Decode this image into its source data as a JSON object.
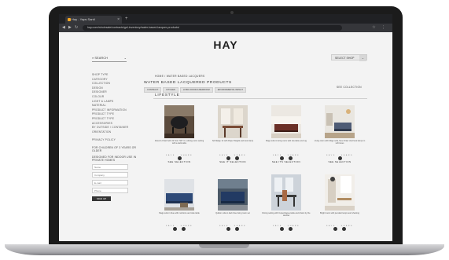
{
  "browser": {
    "tab_title": "Hay - Yaps Santi",
    "new_tab": "+",
    "url": "hay.com/wholesale/contracts/gel-inventory/water-based-lacquer-products/"
  },
  "site": {
    "logo": "HAY",
    "search_label": "SEARCH",
    "location_select": "SELECT SHOP",
    "sidebar_items": [
      "SHOP TYPE",
      "CATEGORY",
      "COLLECTION",
      "DESIGN",
      "DESIGNER",
      "COLOUR",
      "LIGHT & LAMPS",
      "MATERIAL",
      "PRODUCT INFORMATION",
      "PRODUCT TYPE",
      "PRODUCT TYPE",
      "ACCESSORIES",
      "BY OUTSIDE / CONTAINER",
      "ORIENTATION"
    ],
    "sidebar_link": "PRIVACY POLICY",
    "sidebar_note": "FOR CHILDREN OF 3 YEARS OR OLDER",
    "sidebar_note2": "DESIGNED FOR INDOOR USE IN PRIVATE HOMES",
    "sidebar_fields": [
      "Name",
      "Company",
      "E-mail",
      "Phone"
    ],
    "sidebar_button": "SIGN UP"
  },
  "main": {
    "breadcrumb": "HOME / WATER BASED LACQUERS",
    "heading": "WATER BASED LACQUERED PRODUCTS",
    "filters": [
      "CONTRACT",
      "KITCHEN",
      "LIVING ROOM & BEDROOM",
      "ENVIRONMENTAL IMPACT"
    ],
    "see_all": "SEE COLLECTION",
    "section_title": "LIFESTYLE",
    "cards": [
      {
        "caption": "About A Chair AAC 22 from HAY in a dining room setting with a dark table",
        "button": "SEE SELECTION"
      },
      {
        "caption": "Soft Edge 12 with Paper Weight and desk lamp",
        "button": "SEE IT SELECTION"
      },
      {
        "caption": "Mags sofa in living room with low table and rug",
        "button": "SEE ITS SELECTION"
      },
      {
        "caption": "Living room with Mags sofa, New Order shelf and lamps in soft tones",
        "button": "SEE SELECTION"
      },
      {
        "caption": "Mags sofa in blue with cushions and side table",
        "button": ""
      },
      {
        "caption": "Quilton sofa in dark blue living room set",
        "button": ""
      },
      {
        "caption": "Dining setting with Copenhague table and chairs by the window",
        "button": ""
      },
      {
        "caption": "Bright room with pendant lamps and shelving",
        "button": ""
      }
    ],
    "action_labels": "SAVE · SHARE",
    "colors": {
      "accent": "#222222",
      "page_bg": "#f3f3f3"
    }
  }
}
